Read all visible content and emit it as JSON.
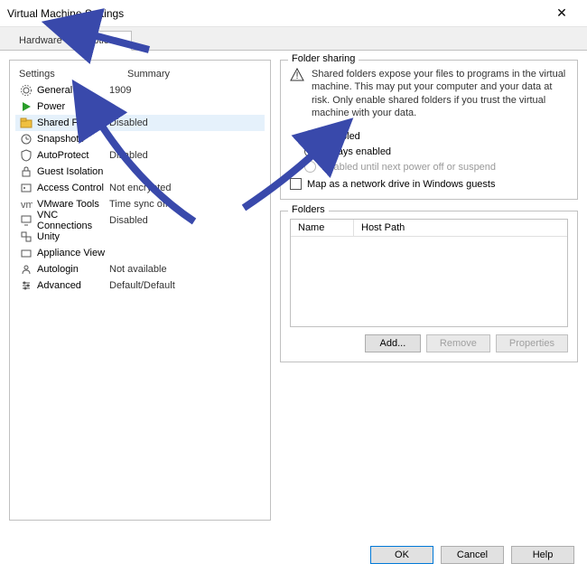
{
  "window": {
    "title": "Virtual Machine Settings",
    "close": "✕"
  },
  "tabs": {
    "hardware": "Hardware",
    "options": "Options"
  },
  "list": {
    "header": {
      "settings": "Settings",
      "summary": "Summary"
    },
    "rows": [
      {
        "icon": "gear-icon",
        "label": "General",
        "summary": "1909"
      },
      {
        "icon": "play-icon",
        "label": "Power",
        "summary": ""
      },
      {
        "icon": "folder-icon",
        "label": "Shared Folders",
        "summary": "Disabled"
      },
      {
        "icon": "clock-icon",
        "label": "Snapshots",
        "summary": ""
      },
      {
        "icon": "shield-icon",
        "label": "AutoProtect",
        "summary": "Disabled"
      },
      {
        "icon": "lock-icon",
        "label": "Guest Isolation",
        "summary": ""
      },
      {
        "icon": "key-icon",
        "label": "Access Control",
        "summary": "Not encrypted"
      },
      {
        "icon": "tools-icon",
        "label": "VMware Tools",
        "summary": "Time sync off"
      },
      {
        "icon": "monitor-icon",
        "label": "VNC Connections",
        "summary": "Disabled"
      },
      {
        "icon": "unity-icon",
        "label": "Unity",
        "summary": ""
      },
      {
        "icon": "box-icon",
        "label": "Appliance View",
        "summary": ""
      },
      {
        "icon": "user-icon",
        "label": "Autologin",
        "summary": "Not available"
      },
      {
        "icon": "advanced-icon",
        "label": "Advanced",
        "summary": "Default/Default"
      }
    ]
  },
  "folder_sharing": {
    "title": "Folder sharing",
    "warning": "Shared folders expose your files to programs in the virtual machine. This may put your computer and your data at risk. Only enable shared folders if you trust the virtual machine with your data.",
    "opt_disabled": "Disabled",
    "opt_always": "Always enabled",
    "opt_until": "Enabled until next power off or suspend",
    "map_drive": "Map as a network drive in Windows guests"
  },
  "folders": {
    "title": "Folders",
    "col_name": "Name",
    "col_hostpath": "Host Path",
    "btn_add": "Add...",
    "btn_remove": "Remove",
    "btn_props": "Properties"
  },
  "buttons": {
    "ok": "OK",
    "cancel": "Cancel",
    "help": "Help"
  }
}
